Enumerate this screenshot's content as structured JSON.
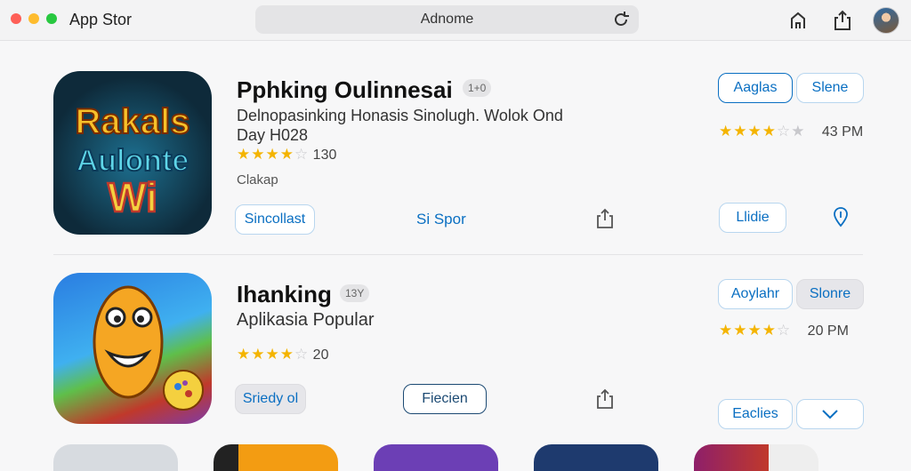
{
  "window": {
    "title": "App Stor"
  },
  "search": {
    "value": "Adnome"
  },
  "apps": [
    {
      "name": "Pphking Oulinnesai",
      "age_badge": "1+0",
      "description": "Delnopasinking Honasis Sinolugh. Wolok Ond Day H028",
      "rating_stars": 3.5,
      "rating_text": "130",
      "caption": "Clakap",
      "icon_text": [
        "Rakals",
        "Aulonte",
        "Wi"
      ],
      "actions": {
        "left_link": "Sincollast",
        "mid_link": "Si Spor",
        "right_pill": "Llidie"
      },
      "side": {
        "btn1": "Aaglas",
        "btn2": "Slene",
        "stars": 3.5,
        "meta": "43 PM"
      }
    },
    {
      "name": "Ihanking",
      "age_badge": "13Y",
      "description": "Aplikasia Popular",
      "rating_stars": 4.5,
      "rating_text": "20",
      "actions": {
        "left_link": "Sriedy ol",
        "mid_pill": "Fiecien",
        "right_pill": "Eaclies"
      },
      "side": {
        "btn1": "Aoylahr",
        "btn2": "Slonre",
        "stars": 4.5,
        "meta": "20 PM"
      }
    }
  ],
  "colors": {
    "accent": "#0a6fc2",
    "star": "#f4b400",
    "background": "#f7f7f8"
  },
  "icons": [
    "reload-icon",
    "home-icon",
    "share-icon",
    "avatar",
    "share-icon",
    "location-icon",
    "chevron-down-icon"
  ]
}
